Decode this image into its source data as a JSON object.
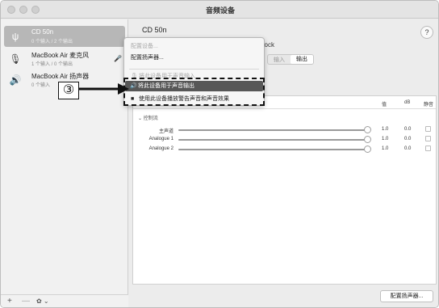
{
  "window": {
    "title": "音频设备"
  },
  "sidebar": {
    "devices": [
      {
        "name": "CD 50n",
        "sub": "0 个输入 / 2 个输出",
        "icon": "usb-icon",
        "selected": true
      },
      {
        "name": "MacBook Air 麦克风",
        "sub": "1 个输入 / 0 个输出",
        "icon": "microphone-icon",
        "selected": false
      },
      {
        "name": "MacBook Air 扬声器",
        "sub": "0 个输入",
        "icon": "speaker-icon",
        "selected": false
      }
    ],
    "add_label": "+",
    "remove_label": "—",
    "gear_label": "✿ ⌄"
  },
  "main": {
    "title": "CD 50n",
    "help": "?",
    "clock_label": "Clock",
    "seg_input": "输入",
    "seg_output": "输出",
    "columns": {
      "value": "值",
      "db": "dB",
      "mute": "静音"
    },
    "group_label": "⌄ 控制流",
    "channels": [
      {
        "name": "主声道",
        "value": "1.0",
        "db": "0.0"
      },
      {
        "name": "Analogue 1",
        "value": "1.0",
        "db": "0.0"
      },
      {
        "name": "Analogue 2",
        "value": "1.0",
        "db": "0.0"
      }
    ],
    "config_button": "配置扬声器..."
  },
  "context_menu": {
    "configure_device": "配置设备...",
    "configure_speakers": "配置扬声器...",
    "use_for_input": "将此设备用于声音输入",
    "use_for_output": "将此设备用于声音输出",
    "use_for_alerts": "使用此设备播放警告声音和声音效果"
  },
  "callout": {
    "number": "③"
  },
  "colors": {
    "highlight": "#575757",
    "selected_row": "#b7b7b7"
  }
}
